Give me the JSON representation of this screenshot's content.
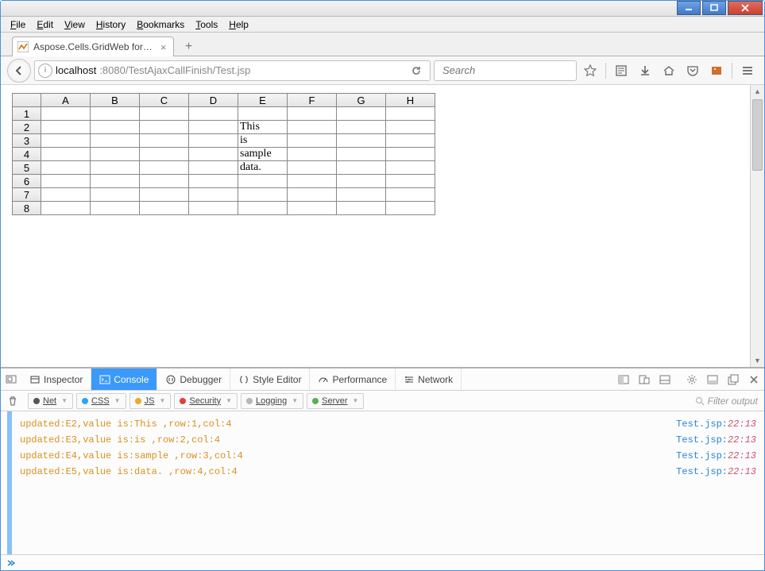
{
  "menubar": [
    "File",
    "Edit",
    "View",
    "History",
    "Bookmarks",
    "Tools",
    "Help"
  ],
  "tab": {
    "title": "Aspose.Cells.GridWeb for J..."
  },
  "url": {
    "host": "localhost",
    "port_path": ":8080/TestAjaxCallFinish/Test.jsp"
  },
  "search": {
    "placeholder": "Search"
  },
  "sheet": {
    "cols": [
      "A",
      "B",
      "C",
      "D",
      "E",
      "F",
      "G",
      "H"
    ],
    "rows": [
      "1",
      "2",
      "3",
      "4",
      "5",
      "6",
      "7",
      "8"
    ],
    "cells": {
      "E2": "This",
      "E3": "is",
      "E4": "sample",
      "E5": "data."
    }
  },
  "devtools": {
    "tabs": [
      {
        "icon": "pick",
        "label": ""
      },
      {
        "icon": "box",
        "label": "Inspector"
      },
      {
        "icon": "console",
        "label": "Console",
        "active": true
      },
      {
        "icon": "debug",
        "label": "Debugger"
      },
      {
        "icon": "braces",
        "label": "Style Editor"
      },
      {
        "icon": "gauge",
        "label": "Performance"
      },
      {
        "icon": "net",
        "label": "Network"
      }
    ],
    "filters": [
      {
        "color": "#555",
        "label": "Net"
      },
      {
        "color": "#2aa6f2",
        "label": "CSS"
      },
      {
        "color": "#f0a830",
        "label": "JS"
      },
      {
        "color": "#e0403a",
        "label": "Security"
      },
      {
        "color": "#b8b8b8",
        "label": "Logging"
      },
      {
        "color": "#5aab5a",
        "label": "Server"
      }
    ],
    "filter_placeholder": "Filter output",
    "logs": [
      {
        "msg": "updated:E2,value is:This ,row:1,col:4",
        "src": "Test.jsp",
        "line": "22:13"
      },
      {
        "msg": "updated:E3,value is:is ,row:2,col:4",
        "src": "Test.jsp",
        "line": "22:13"
      },
      {
        "msg": "updated:E4,value is:sample ,row:3,col:4",
        "src": "Test.jsp",
        "line": "22:13"
      },
      {
        "msg": "updated:E5,value is:data. ,row:4,col:4",
        "src": "Test.jsp",
        "line": "22:13"
      }
    ]
  }
}
